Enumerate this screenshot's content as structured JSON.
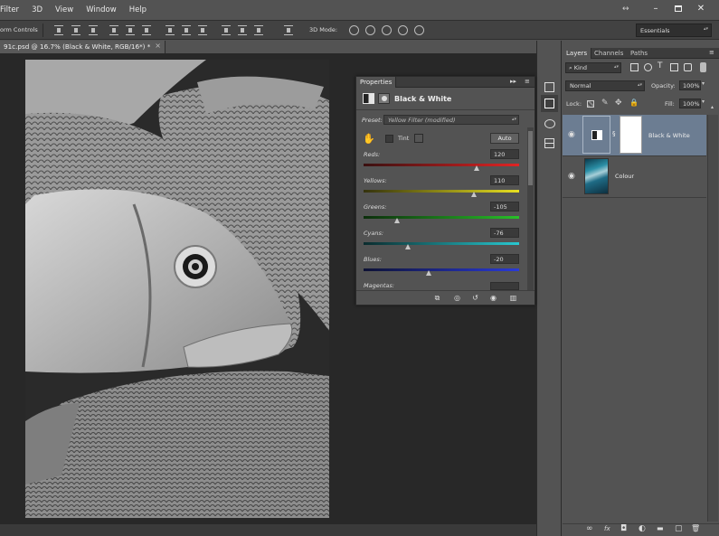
{
  "menubar": {
    "items": [
      "Filter",
      "3D",
      "View",
      "Window",
      "Help"
    ],
    "window_controls": [
      "minimize",
      "maximize",
      "close"
    ]
  },
  "options": {
    "transform_label": "orm Controls",
    "mode3d_label": "3D Mode:",
    "workspace": "Essentials"
  },
  "document": {
    "tab_title": "91c.psd @ 16.7% (Black & White, RGB/16*) *",
    "close_glyph": "×"
  },
  "properties": {
    "tab_label": "Properties",
    "panel_menu": "≡",
    "collapse": "▸▸",
    "adjustment_title": "Black & White",
    "preset_label": "Preset:",
    "preset_value": "Yellow Filter (modified)",
    "tint_label": "Tint",
    "auto_label": "Auto",
    "sliders": [
      {
        "label": "Reds:",
        "value": "120",
        "position": 0.73,
        "gradient": [
          "#3a1010",
          "#e02424"
        ]
      },
      {
        "label": "Yellows:",
        "value": "110",
        "position": 0.71,
        "gradient": [
          "#34320e",
          "#e8e020"
        ]
      },
      {
        "label": "Greens:",
        "value": "-105",
        "position": 0.22,
        "gradient": [
          "#0c2e0c",
          "#28c028"
        ]
      },
      {
        "label": "Cyans:",
        "value": "-76",
        "position": 0.29,
        "gradient": [
          "#0b2c2e",
          "#28c8d0"
        ]
      },
      {
        "label": "Blues:",
        "value": "-20",
        "position": 0.42,
        "gradient": [
          "#0e1234",
          "#2a3ad8"
        ]
      },
      {
        "label": "Magentas:",
        "value": "",
        "position": 0.5,
        "gradient": [
          "#2e0c2c",
          "#d028c8"
        ]
      }
    ],
    "footer_icons": [
      "clip-icon",
      "view-previous-icon",
      "reset-icon",
      "visibility-icon",
      "trash-icon"
    ]
  },
  "layers": {
    "tabs": [
      "Layers",
      "Channels",
      "Paths"
    ],
    "kind_label": "Kind",
    "blend_mode": "Normal",
    "opacity_label": "Opacity:",
    "opacity_value": "100%",
    "lock_label": "Lock:",
    "fill_label": "Fill:",
    "fill_value": "100%",
    "rows": [
      {
        "name": "Black & White",
        "selected": true
      },
      {
        "name": "Colour",
        "selected": false
      }
    ],
    "footer_glyphs": [
      "∞",
      "fx",
      "◘",
      "◐",
      "▬",
      "▢",
      "🗑"
    ]
  },
  "colors": {
    "selection": "#6c7d92",
    "panel": "#535353",
    "canvas": "#282828"
  }
}
